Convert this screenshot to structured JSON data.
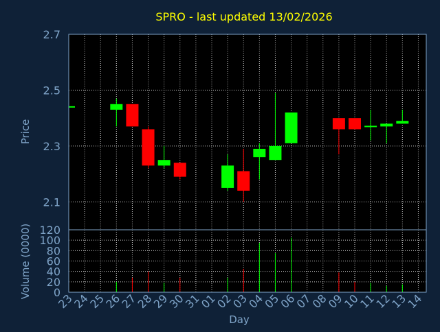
{
  "chart_data": [
    {
      "type": "candlestick",
      "title": "SPRO - last updated 13/02/2026",
      "ylabel": "Price",
      "ylim": [
        2.0,
        2.7
      ],
      "yticks": [
        "2.1",
        "2.3",
        "2.5",
        "2.7"
      ],
      "grid": true,
      "categories": [
        "23",
        "24",
        "25",
        "26",
        "27",
        "28",
        "29",
        "30",
        "31",
        "01",
        "02",
        "03",
        "04",
        "05",
        "06",
        "07",
        "08",
        "09",
        "10",
        "11",
        "12",
        "13",
        "14"
      ],
      "candles": [
        {
          "day": "23",
          "open": 2.44,
          "high": 2.44,
          "low": 2.44,
          "close": 2.44
        },
        {
          "day": "26",
          "open": 2.43,
          "high": 2.47,
          "low": 2.37,
          "close": 2.45
        },
        {
          "day": "27",
          "open": 2.45,
          "high": 2.45,
          "low": 2.37,
          "close": 2.37
        },
        {
          "day": "28",
          "open": 2.36,
          "high": 2.37,
          "low": 2.22,
          "close": 2.23
        },
        {
          "day": "29",
          "open": 2.23,
          "high": 2.3,
          "low": 2.22,
          "close": 2.25
        },
        {
          "day": "30",
          "open": 2.24,
          "high": 2.24,
          "low": 2.18,
          "close": 2.19
        },
        {
          "day": "02",
          "open": 2.15,
          "high": 2.27,
          "low": 2.14,
          "close": 2.23
        },
        {
          "day": "03",
          "open": 2.21,
          "high": 2.29,
          "low": 2.1,
          "close": 2.14
        },
        {
          "day": "04",
          "open": 2.26,
          "high": 2.31,
          "low": 2.18,
          "close": 2.29
        },
        {
          "day": "05",
          "open": 2.25,
          "high": 2.49,
          "low": 2.25,
          "close": 2.3
        },
        {
          "day": "06",
          "open": 2.31,
          "high": 2.42,
          "low": 2.31,
          "close": 2.42
        },
        {
          "day": "09",
          "open": 2.4,
          "high": 2.4,
          "low": 2.27,
          "close": 2.36
        },
        {
          "day": "10",
          "open": 2.4,
          "high": 2.4,
          "low": 2.36,
          "close": 2.36
        },
        {
          "day": "11",
          "open": 2.37,
          "high": 2.43,
          "low": 2.32,
          "close": 2.37
        },
        {
          "day": "12",
          "open": 2.37,
          "high": 2.38,
          "low": 2.31,
          "close": 2.38
        },
        {
          "day": "13",
          "open": 2.38,
          "high": 2.43,
          "low": 2.38,
          "close": 2.39
        }
      ]
    },
    {
      "type": "bar",
      "xlabel": "Day",
      "ylabel": "Volume (0000)",
      "ylim": [
        0,
        120
      ],
      "yticks": [
        "0",
        "20",
        "40",
        "60",
        "80",
        "100",
        "120"
      ],
      "grid": true,
      "categories": [
        "23",
        "24",
        "25",
        "26",
        "27",
        "28",
        "29",
        "30",
        "31",
        "01",
        "02",
        "03",
        "04",
        "05",
        "06",
        "07",
        "08",
        "09",
        "10",
        "11",
        "12",
        "13",
        "14"
      ],
      "volumes": [
        {
          "day": "26",
          "value": 20,
          "direction": "up"
        },
        {
          "day": "27",
          "value": 28,
          "direction": "down"
        },
        {
          "day": "28",
          "value": 40,
          "direction": "down"
        },
        {
          "day": "29",
          "value": 18,
          "direction": "up"
        },
        {
          "day": "30",
          "value": 28,
          "direction": "down"
        },
        {
          "day": "02",
          "value": 28,
          "direction": "up"
        },
        {
          "day": "03",
          "value": 45,
          "direction": "down"
        },
        {
          "day": "04",
          "value": 95,
          "direction": "up"
        },
        {
          "day": "05",
          "value": 75,
          "direction": "up"
        },
        {
          "day": "06",
          "value": 105,
          "direction": "up"
        },
        {
          "day": "09",
          "value": 38,
          "direction": "down"
        },
        {
          "day": "10",
          "value": 20,
          "direction": "down"
        },
        {
          "day": "11",
          "value": 18,
          "direction": "up"
        },
        {
          "day": "12",
          "value": 12,
          "direction": "up"
        },
        {
          "day": "13",
          "value": 15,
          "direction": "up"
        }
      ]
    }
  ],
  "colors": {
    "background": "#0f2137",
    "plot_background": "#000000",
    "grid": "#c8c8c8",
    "axis_text": "#7fa4c8",
    "title": "#ffff00",
    "up": "#00ff00",
    "down": "#ff0000"
  }
}
